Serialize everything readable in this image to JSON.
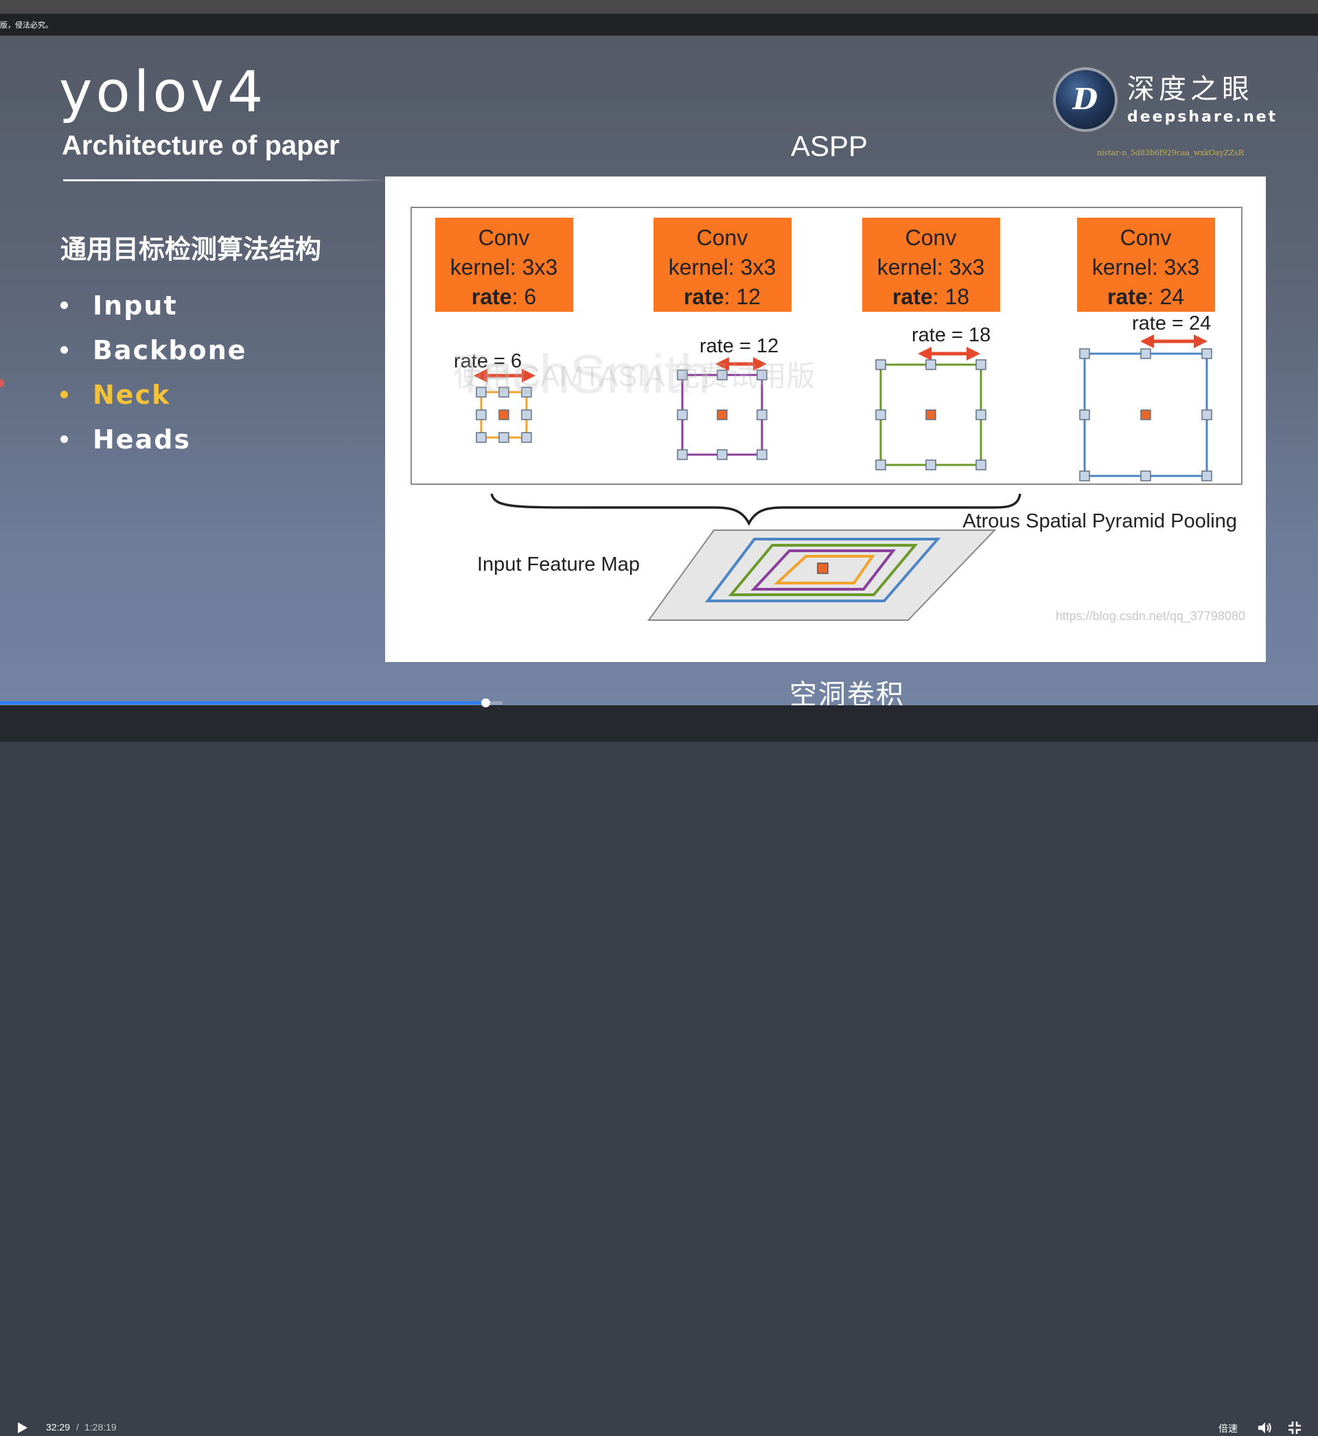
{
  "notice": "版，侵法必究。",
  "slide": {
    "title": "yolov4",
    "subtitle": "Architecture of paper",
    "section_heading": "通用目标检测算法结构",
    "bullets": [
      {
        "label": "Input",
        "active": false
      },
      {
        "label": "Backbone",
        "active": false
      },
      {
        "label": "Neck",
        "active": true
      },
      {
        "label": "Heads",
        "active": false
      }
    ],
    "figure_title": "ASPP",
    "caption": "空洞卷积"
  },
  "logo": {
    "letter": "D",
    "cn": "深度之眼",
    "en": "deepshare.net",
    "watermark_id": "nistar-n_5d83b6f929caa_wxkOayZZsR"
  },
  "diagram": {
    "conv_blocks": [
      {
        "line1": "Conv",
        "line2": "kernel: 3x3",
        "rate_key": "rate",
        "rate_value": ": 6",
        "rate_label": "rate = 6"
      },
      {
        "line1": "Conv",
        "line2": "kernel: 3x3",
        "rate_key": "rate",
        "rate_value": ": 12",
        "rate_label": "rate = 12"
      },
      {
        "line1": "Conv",
        "line2": "kernel: 3x3",
        "rate_key": "rate",
        "rate_value": ": 18",
        "rate_label": "rate = 18"
      },
      {
        "line1": "Conv",
        "line2": "kernel: 3x3",
        "rate_key": "rate",
        "rate_value": ": 24",
        "rate_label": "rate = 24"
      }
    ],
    "pooling_label": "Atrous Spatial Pyramid Pooling",
    "input_label": "Input Feature Map",
    "watermark_brand": "TechSmith",
    "watermark_trial": "使用 CAMTASIA 免费试用版",
    "source_url": "https://blog.csdn.net/qq_37798080",
    "colors": {
      "conv": "#fb7621",
      "rate6": "#f3a32b",
      "rate12": "#8a3f9b",
      "rate18": "#6b9a2a",
      "rate24": "#4d86c4",
      "center": "#e8682a",
      "arrow": "#e5492d",
      "tap_fill": "#c7d4e6",
      "tap_stroke": "#627085"
    }
  },
  "player": {
    "current_time": "32:29",
    "separator": "/",
    "total_time": "1:28:19",
    "progress": 0.368,
    "buffered": 0.381,
    "speed_label": "倍速",
    "play_icon": "play-icon",
    "volume_icon": "volume-icon",
    "fullscreen_icon": "exit-fullscreen-icon"
  }
}
